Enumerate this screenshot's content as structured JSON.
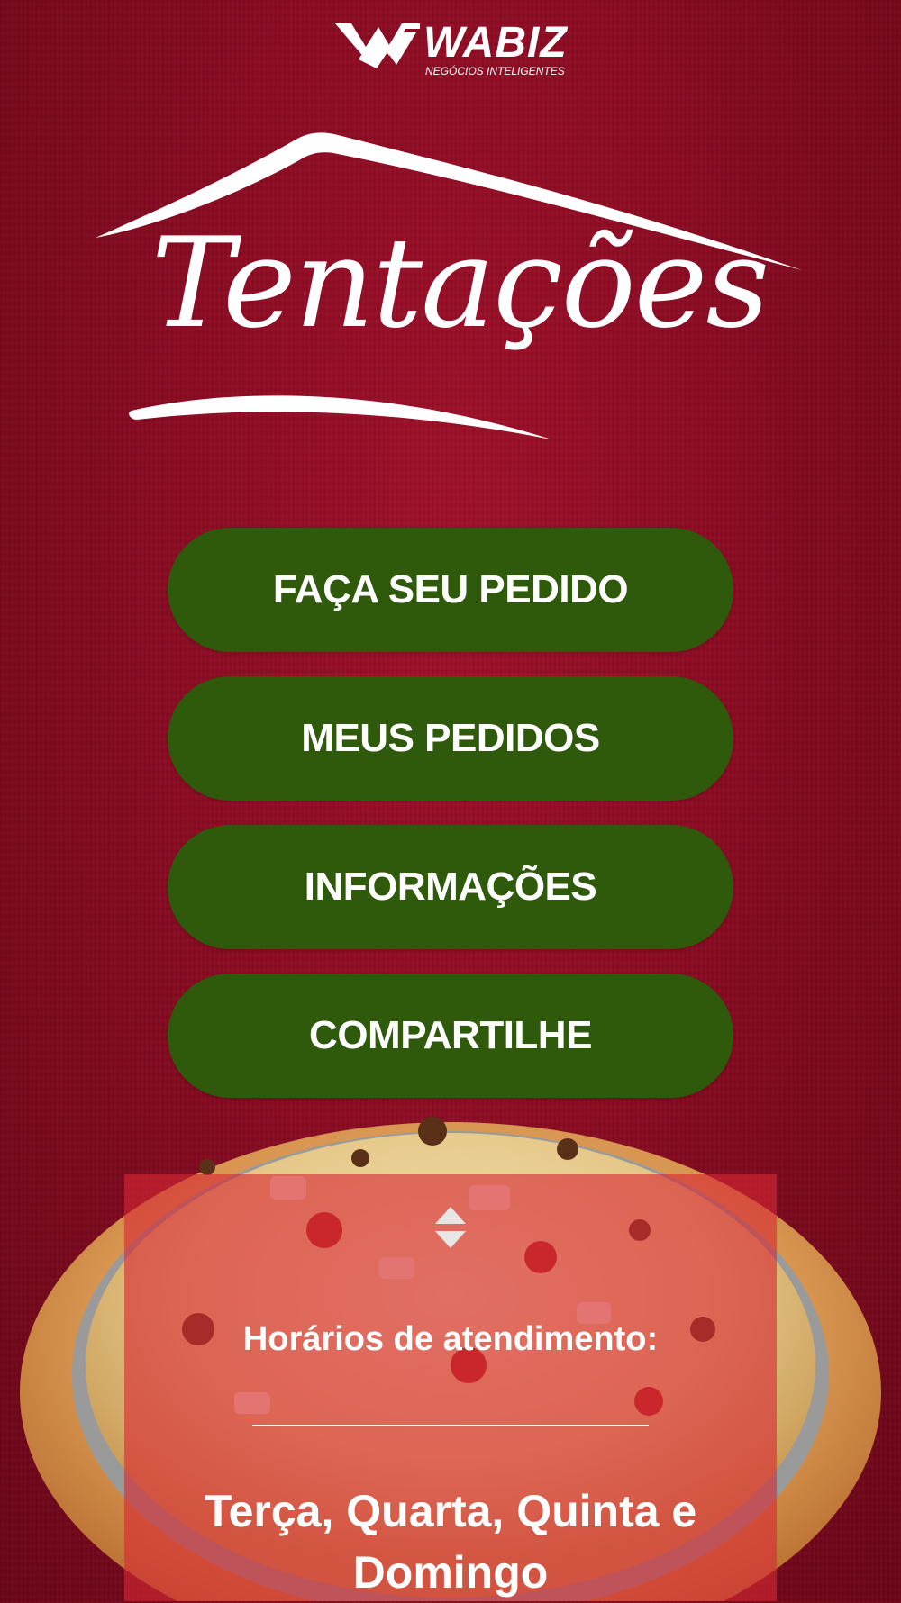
{
  "brand": {
    "name": "WABIZ",
    "tagline": "NEGÓCIOS INTELIGENTES"
  },
  "restaurant": {
    "name": "Tentações"
  },
  "menu": [
    {
      "label": "FAÇA SEU PEDIDO"
    },
    {
      "label": "MEUS PEDIDOS"
    },
    {
      "label": "INFORMAÇÕES"
    },
    {
      "label": "COMPARTILHE"
    }
  ],
  "hours": {
    "title": "Horários de atendimento:",
    "days": "Terça, Quarta, Quinta e Domingo"
  },
  "colors": {
    "background": "#8a0b22",
    "button": "#2f5a0c",
    "panel": "#d62834"
  },
  "icons": {
    "brand": "wabiz-logo-icon",
    "sort": "sort-up-down-icon",
    "hero": "pizza-image"
  }
}
